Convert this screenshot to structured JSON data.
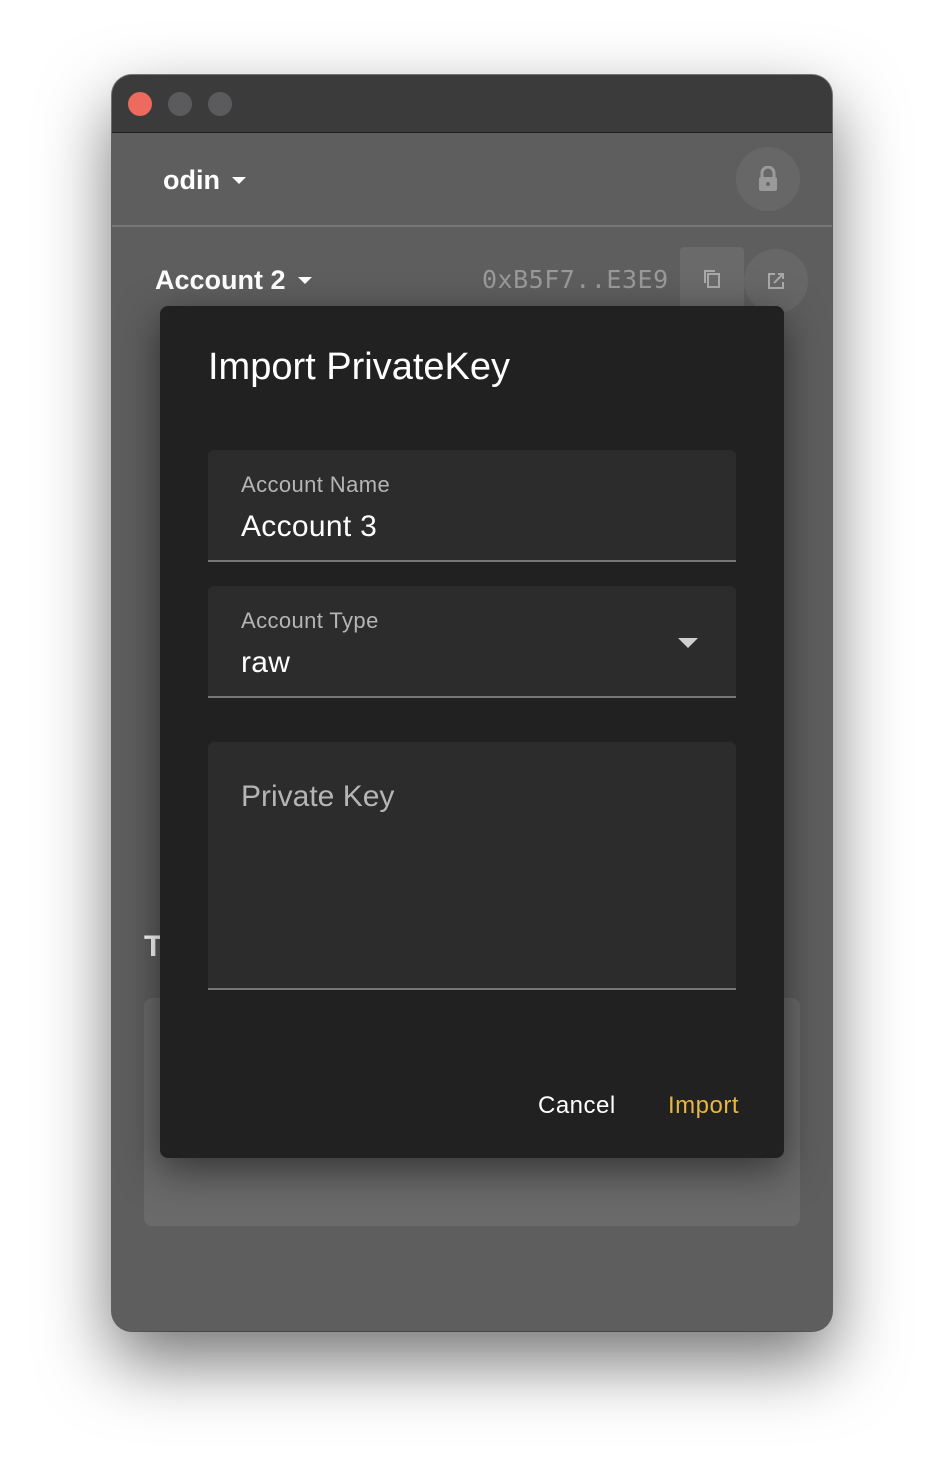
{
  "app": {
    "wallet_name": "odin"
  },
  "account": {
    "name": "Account 2",
    "address": "0xB5F7..E3E9"
  },
  "background": {
    "heading_partial": "T"
  },
  "dialog": {
    "title": "Import PrivateKey",
    "account_name_label": "Account Name",
    "account_name_value": "Account 3",
    "account_type_label": "Account Type",
    "account_type_value": "raw",
    "private_key_placeholder": "Private Key",
    "cancel_label": "Cancel",
    "import_label": "Import"
  },
  "colors": {
    "accent": "#e6b73e",
    "close_light": "#ec6a5e",
    "dialog_bg": "#212121",
    "window_bg": "#5e5e5e"
  },
  "icons": [
    "lock-icon",
    "copy-icon",
    "open-external-icon",
    "chevron-down-icon"
  ]
}
